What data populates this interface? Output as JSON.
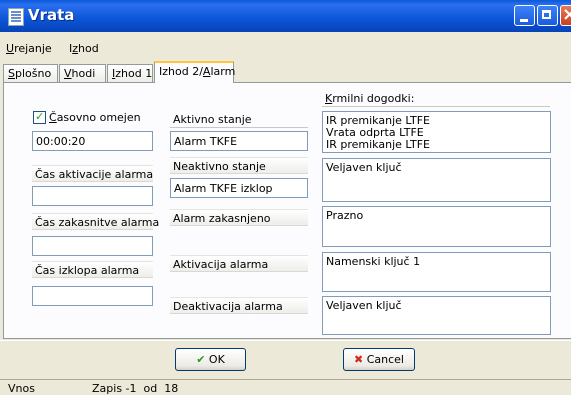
{
  "window": {
    "title": "Vrata",
    "icon": "form-icon"
  },
  "menu": [
    {
      "label": "Urejanje",
      "accel": "U"
    },
    {
      "label": "Izhod",
      "accel": "z"
    }
  ],
  "tabs": [
    {
      "label": "Splošno"
    },
    {
      "label": "Vhodi"
    },
    {
      "label": "Izhod 1"
    },
    {
      "label": "Izhod 2/Alarm",
      "active": true
    }
  ],
  "left": {
    "timed_label": "Časovno omejen",
    "timed_checked": true,
    "timed_value": "00:00:20",
    "activation_label": "Čas aktivacije alarma",
    "activation_value": "",
    "delay_label": "Čas zakasnitve alarma",
    "delay_value": "",
    "shutoff_label": "Čas izklopa alarma",
    "shutoff_value": ""
  },
  "middle": {
    "active_state_label": "Aktivno stanje",
    "active_state_value": "Alarm TKFE",
    "inactive_state_label": "Neaktivno stanje",
    "inactive_state_value": "Alarm TKFE izklop",
    "alarm_delayed_label": "Alarm zakasnjeno",
    "alarm_activation_label": "Aktivacija alarma",
    "alarm_deactivation_label": "Deaktivacija alarma"
  },
  "right": {
    "header": "Krmilni dogodki:",
    "active_events": [
      "IR premikanje LTFE",
      "Vrata odprta LTFE",
      "IR premikanje LTFE"
    ],
    "inactive_events": [
      "Veljaven ključ"
    ],
    "delayed_events": [
      "Prazno"
    ],
    "activation_events": [
      "Namenski ključ 1"
    ],
    "deactivation_events": [
      "Veljaven ključ"
    ]
  },
  "buttons": {
    "ok": "OK",
    "cancel": "Cancel"
  },
  "status": {
    "mode": "Vnos",
    "record": "Zapis -1  od  18"
  },
  "colors": {
    "titlebar": "#0a55d6",
    "window_bg": "#ece9d8",
    "tab_highlight": "#ffc83c",
    "ok_icon": "#2a9a2a",
    "cancel_icon": "#d02a1a"
  }
}
